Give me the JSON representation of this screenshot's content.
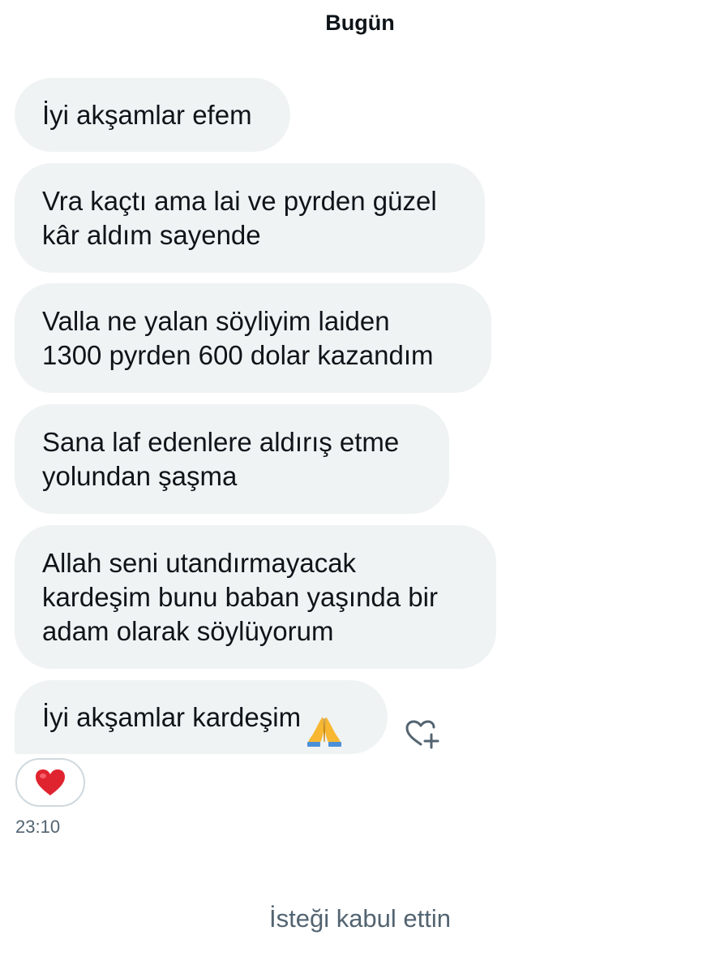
{
  "header": {
    "date_label": "Bugün"
  },
  "messages": [
    {
      "text": "İyi akşamlar efem"
    },
    {
      "text": "Vra kaçtı ama lai ve pyrden güzel\nkâr aldım sayende"
    },
    {
      "text": "Valla ne yalan söyliyim laiden\n1300 pyrden 600 dolar kazandım"
    },
    {
      "text": "Sana laf edenlere aldırış etme\nyolundan şaşma"
    },
    {
      "text": "Allah seni utandırmayacak\nkardeşim bunu baban yaşında bir\nadam olarak söylüyorum"
    },
    {
      "text": "İyi akşamlar kardeşim",
      "emoji": "folded-hands-emoji"
    }
  ],
  "reaction": {
    "icon": "red-heart-emoji",
    "add_reaction_icon": "heart-plus-icon"
  },
  "timestamp": "23:10",
  "footer": {
    "note": "İsteği kabul ettin"
  },
  "colors": {
    "bubble_bg": "#eff3f4",
    "text": "#0f1419",
    "secondary_text": "#536471",
    "heart": "#e0242f"
  }
}
